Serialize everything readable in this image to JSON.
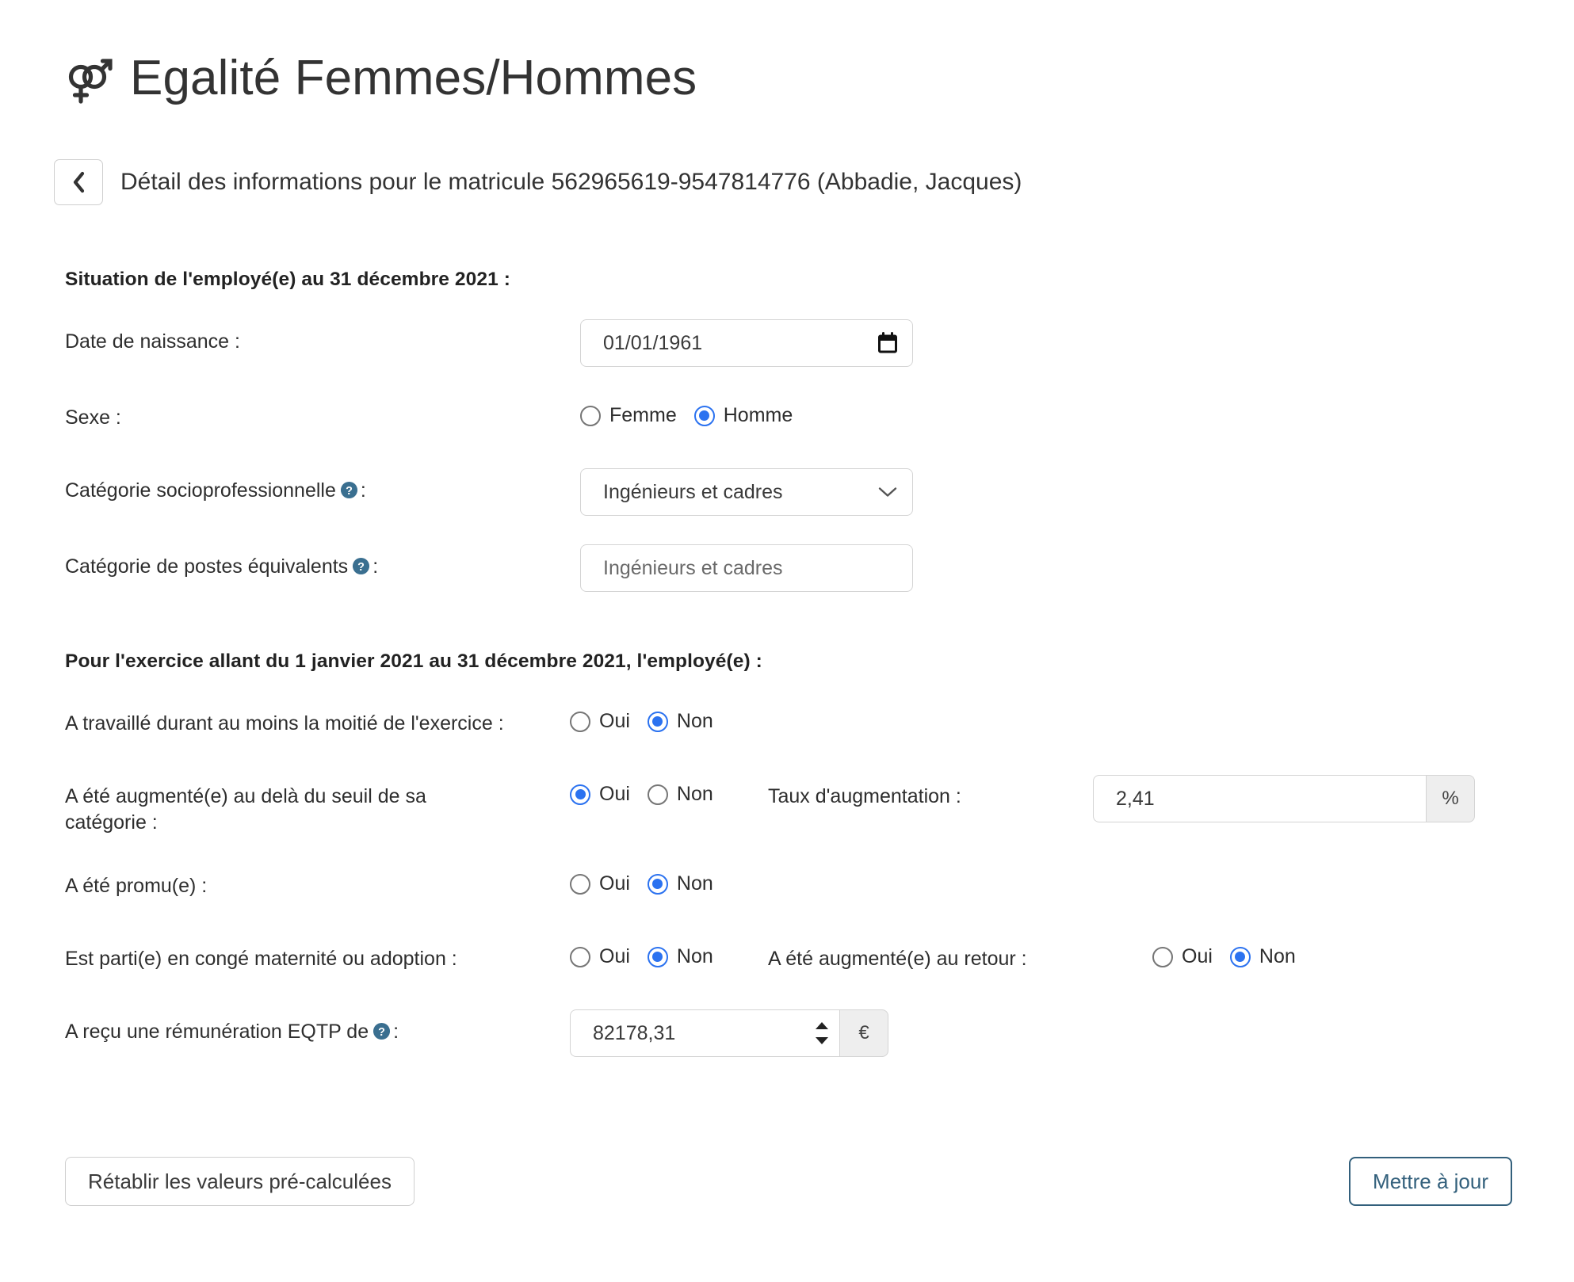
{
  "header": {
    "title": "Egalité Femmes/Hommes",
    "gender_icon": "venus-mars-icon",
    "back_icon": "chevron-left-icon",
    "breadcrumb": "Détail des informations pour le matricule 562965619-9547814776 (Abbadie, Jacques)"
  },
  "situation": {
    "section_title": "Situation de l'employé(e) au 31 décembre 2021 :",
    "birthdate": {
      "label": "Date de naissance :",
      "value": "01/01/1961",
      "icon": "calendar-icon"
    },
    "sex": {
      "label": "Sexe :",
      "options": [
        {
          "label": "Femme",
          "selected": false
        },
        {
          "label": "Homme",
          "selected": true
        }
      ]
    },
    "csp": {
      "label_before": "Catégorie socioprofessionnelle",
      "label_after": ":",
      "help_icon": "help-circle-icon",
      "value": "Ingénieurs et cadres",
      "icon": "chevron-down-icon"
    },
    "equivalent_posts": {
      "label_before": "Catégorie de postes équivalents",
      "label_after": ":",
      "help_icon": "help-circle-icon",
      "value": "Ingénieurs et cadres"
    }
  },
  "exercise": {
    "section_title": "Pour l'exercice allant du 1 janvier 2021 au 31 décembre 2021, l'employé(e) :",
    "worked_half": {
      "label": "A travaillé durant au moins la moitié de l'exercice :",
      "options": [
        {
          "label": "Oui",
          "selected": false
        },
        {
          "label": "Non",
          "selected": true
        }
      ]
    },
    "raised_above_threshold": {
      "label_line1": "A été augmenté(e) au delà du seuil de sa",
      "label_line2": "catégorie :",
      "options": [
        {
          "label": "Oui",
          "selected": true
        },
        {
          "label": "Non",
          "selected": false
        }
      ],
      "rate_label": "Taux d'augmentation :",
      "rate_value": "2,41",
      "rate_unit": "%"
    },
    "promoted": {
      "label": "A été promu(e) :",
      "options": [
        {
          "label": "Oui",
          "selected": false
        },
        {
          "label": "Non",
          "selected": true
        }
      ]
    },
    "maternity_leave": {
      "label": "Est parti(e) en congé maternité ou adoption :",
      "options": [
        {
          "label": "Oui",
          "selected": false
        },
        {
          "label": "Non",
          "selected": true
        }
      ],
      "raised_on_return_label": "A été augmenté(e) au retour :",
      "raised_on_return_options": [
        {
          "label": "Oui",
          "selected": false
        },
        {
          "label": "Non",
          "selected": true
        }
      ]
    },
    "eqtp_pay": {
      "label_before": "A reçu une rémunération EQTP de",
      "label_after": ":",
      "help_icon": "help-circle-icon",
      "value": "82178,31",
      "unit": "€",
      "spinner_icon": "spinner-up-down-icon"
    }
  },
  "footer": {
    "reset_label": "Rétablir les valeurs pré-calculées",
    "update_label": "Mettre à jour"
  },
  "colors": {
    "radio_selected": "#2b72f0",
    "help_icon": "#3a6f90",
    "update_button": "#33607c",
    "text": "#2e2e2e",
    "border": "#d4d4d4",
    "addon_bg": "#eeeeee"
  }
}
